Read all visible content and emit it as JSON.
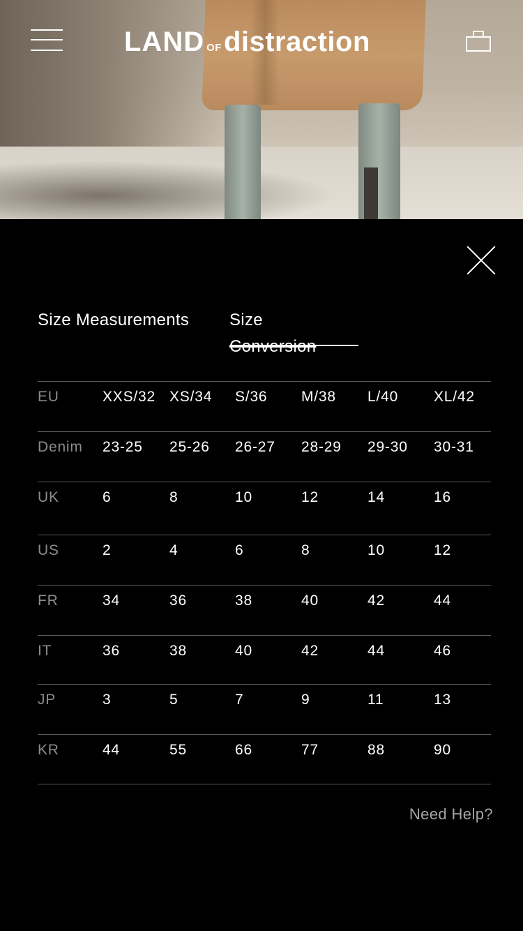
{
  "header": {
    "logo": {
      "land": "LAND",
      "of": "OF",
      "distraction": "distraction"
    },
    "menu_icon": "hamburger-menu-icon",
    "cart_icon": "shopping-bag-icon"
  },
  "hero": {
    "description_icon": "product-photo"
  },
  "modal": {
    "close_icon": "close-icon",
    "tabs": {
      "measurements": "Size Measurements",
      "conversion_line1": "Size",
      "conversion_line2": "Conversion"
    },
    "rows": [
      {
        "label": "EU",
        "values": [
          "XXS/32",
          "XS/34",
          "S/36",
          "M/38",
          "L/40",
          "XL/42"
        ]
      },
      {
        "label": "Denim",
        "values": [
          "23-25",
          "25-26",
          "26-27",
          "28-29",
          "29-30",
          "30-31"
        ]
      },
      {
        "label": "UK",
        "values": [
          "6",
          "8",
          "10",
          "12",
          "14",
          "16"
        ]
      },
      {
        "label": "US",
        "values": [
          "2",
          "4",
          "6",
          "8",
          "10",
          "12"
        ]
      },
      {
        "label": "FR",
        "values": [
          "34",
          "36",
          "38",
          "40",
          "42",
          "44"
        ]
      },
      {
        "label": "IT",
        "values": [
          "36",
          "38",
          "40",
          "42",
          "44",
          "46"
        ]
      },
      {
        "label": "JP",
        "values": [
          "3",
          "5",
          "7",
          "9",
          "11",
          "13"
        ]
      },
      {
        "label": "KR",
        "values": [
          "44",
          "55",
          "66",
          "77",
          "88",
          "90"
        ]
      }
    ],
    "help_link": "Need Help?"
  },
  "colors": {
    "background": "#000000",
    "text": "#ffffff",
    "muted_label": "#8c8c8c",
    "divider": "#5a5a5a",
    "help_text": "#a5a5a5"
  }
}
